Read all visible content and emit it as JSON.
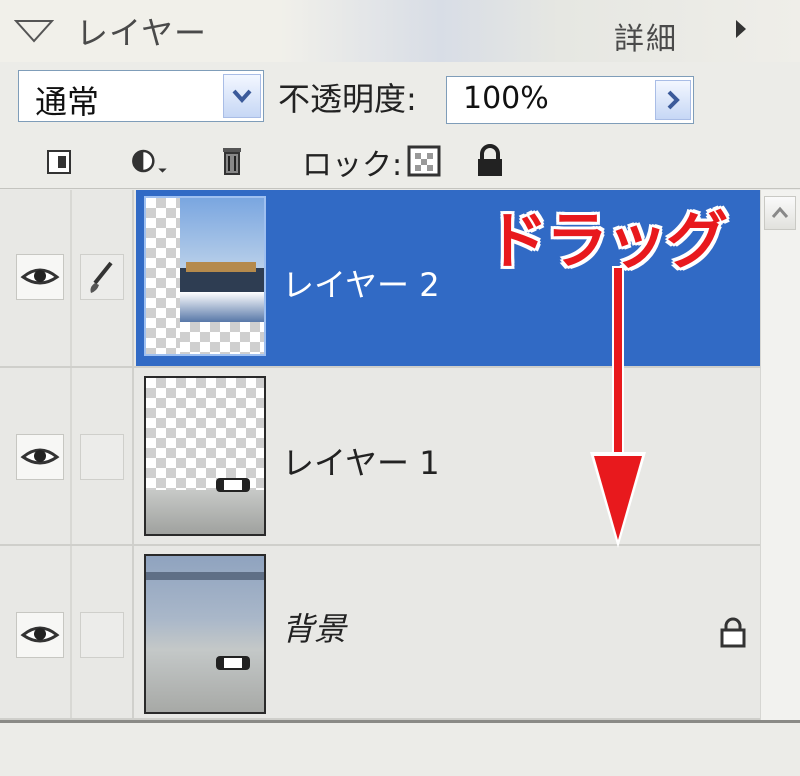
{
  "header": {
    "title": "レイヤー",
    "more_label": "詳細"
  },
  "toolbar": {
    "blend_mode": "通常",
    "opacity_label": "不透明度:",
    "opacity_value": "100%",
    "lock_label": "ロック:"
  },
  "layers": [
    {
      "name": "レイヤー 2",
      "selected": true,
      "visible": true,
      "linked_brush": true
    },
    {
      "name": "レイヤー 1",
      "selected": false,
      "visible": true,
      "linked_brush": false
    },
    {
      "name": "背景",
      "selected": false,
      "visible": true,
      "locked": true
    }
  ],
  "annotation": {
    "drag_label": "ドラッグ",
    "color": "#e8191d"
  },
  "colors": {
    "selection": "#316ac5",
    "panel": "#e8e8e5"
  }
}
